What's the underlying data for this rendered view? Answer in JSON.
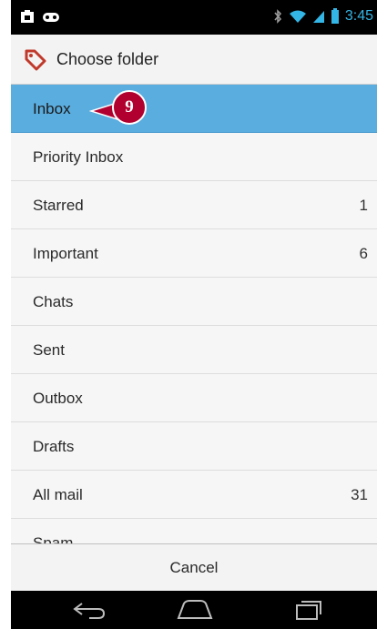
{
  "status_bar": {
    "time": "3:45",
    "icons": [
      "notification-icon",
      "gamepad-icon",
      "bluetooth-icon",
      "wifi-icon",
      "signal-icon",
      "battery-icon"
    ]
  },
  "dialog": {
    "title": "Choose folder",
    "header_icon": "label-tag-icon",
    "accent_color": "#b1002f",
    "selected_color": "#5aaddf"
  },
  "folders": [
    {
      "label": "Inbox",
      "count": "",
      "selected": true
    },
    {
      "label": "Priority Inbox",
      "count": ""
    },
    {
      "label": "Starred",
      "count": "1"
    },
    {
      "label": "Important",
      "count": "6"
    },
    {
      "label": "Chats",
      "count": ""
    },
    {
      "label": "Sent",
      "count": ""
    },
    {
      "label": "Outbox",
      "count": ""
    },
    {
      "label": "Drafts",
      "count": ""
    },
    {
      "label": "All mail",
      "count": "31"
    },
    {
      "label": "Spam",
      "count": ""
    }
  ],
  "callout": {
    "label": "9"
  },
  "cancel_label": "Cancel",
  "nav_bar": {
    "icons": [
      "back-icon",
      "home-icon",
      "recent-apps-icon"
    ]
  }
}
